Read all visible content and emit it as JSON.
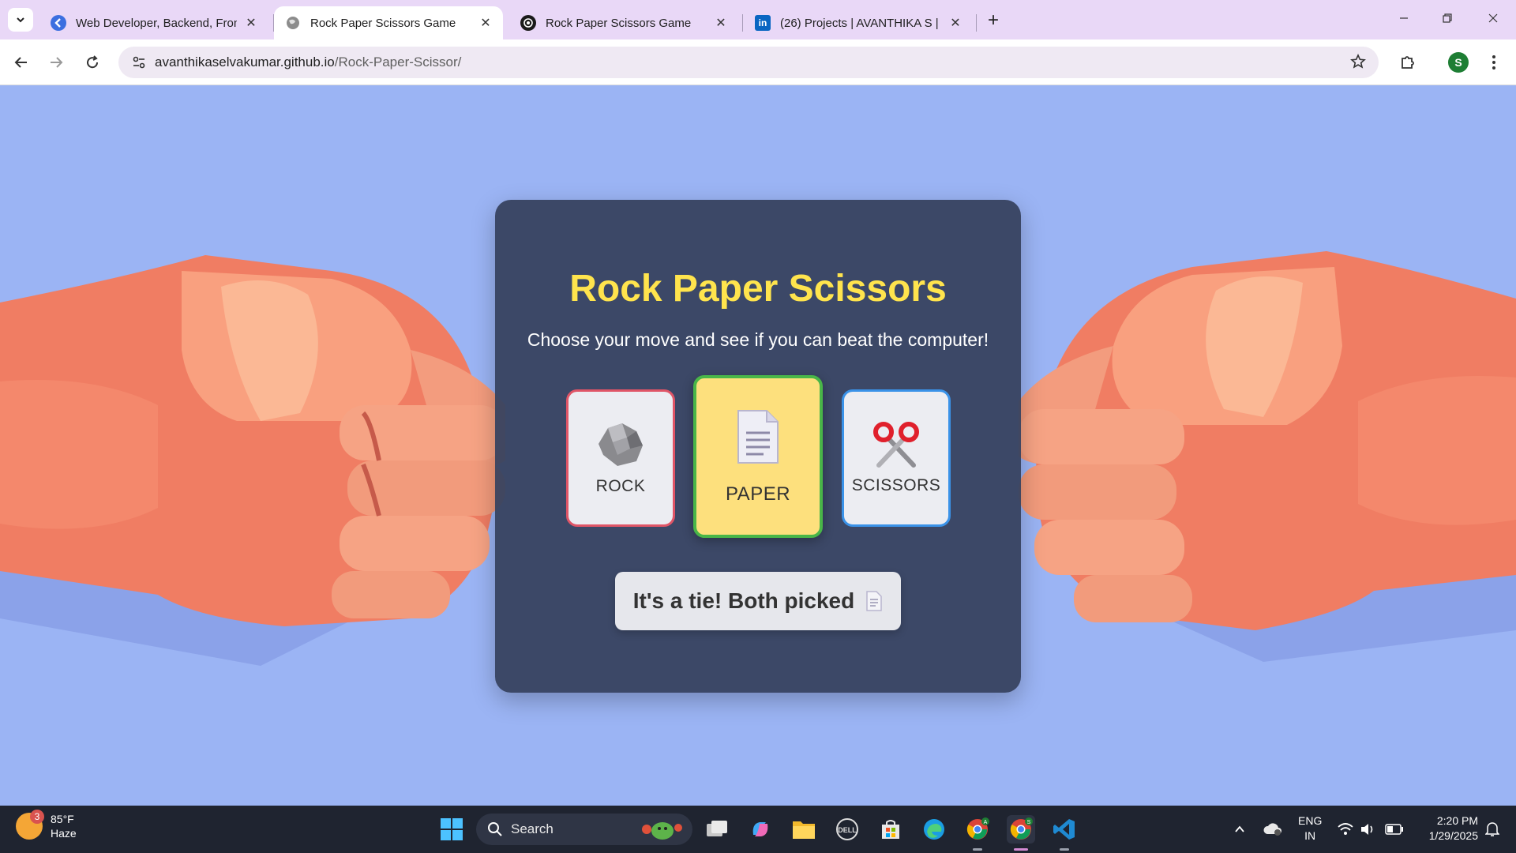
{
  "browser": {
    "tabs": [
      {
        "title": "Web Developer, Backend, Front",
        "favicon": "k-blue-icon",
        "active": false
      },
      {
        "title": "Rock Paper Scissors Game",
        "favicon": "globe-icon",
        "active": true
      },
      {
        "title": "Rock Paper Scissors Game",
        "favicon": "openai-icon",
        "active": false
      },
      {
        "title": "(26) Projects | AVANTHIKA S | Li",
        "favicon": "linkedin-icon",
        "active": false
      }
    ],
    "address": {
      "host": "avanthikaselvakumar.github.io",
      "path": "/Rock-Paper-Scissor/"
    },
    "profile_initial": "S"
  },
  "game": {
    "title": "Rock Paper Scissors",
    "subtitle": "Choose your move and see if you can beat the computer!",
    "choices": [
      {
        "label": "ROCK",
        "icon": "rock-icon",
        "border_color": "#e05567"
      },
      {
        "label": "PAPER",
        "icon": "paper-icon",
        "border_color": "#49b648",
        "selected": true
      },
      {
        "label": "SCISSORS",
        "icon": "scissors-icon",
        "border_color": "#3a92e8"
      }
    ],
    "result": "It's a tie! Both picked",
    "result_icon": "paper-icon",
    "colors": {
      "title": "#ffe44d",
      "card": "#37425f",
      "background": "#9bb4f4"
    }
  },
  "taskbar": {
    "weather": {
      "badge": "3",
      "temp": "85°F",
      "condition": "Haze"
    },
    "search_label": "Search",
    "language": {
      "line1": "ENG",
      "line2": "IN"
    },
    "clock": {
      "time": "2:20 PM",
      "date": "1/29/2025"
    }
  }
}
